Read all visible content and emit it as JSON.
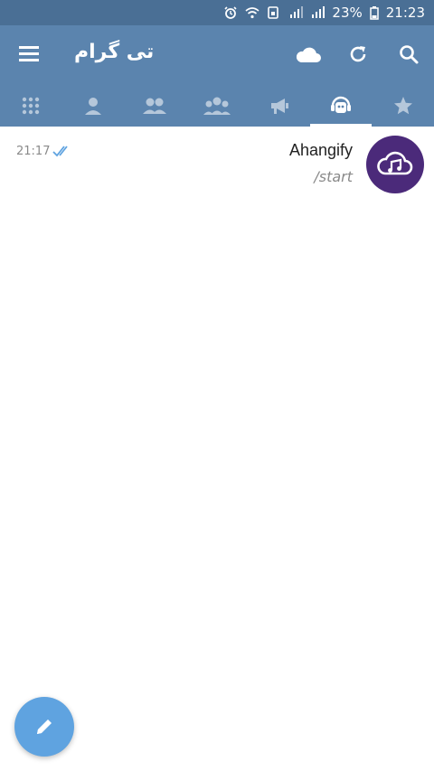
{
  "statusbar": {
    "battery_text": "23%",
    "time": "21:23",
    "icons": [
      "alarm-icon",
      "wifi-icon",
      "sim-icon",
      "signal-icon",
      "signal-icon-2",
      "battery-icon"
    ]
  },
  "appbar": {
    "title": "تی گرام",
    "menu_icon": "hamburger-menu-icon",
    "actions": [
      "cloud-icon",
      "refresh-icon",
      "search-icon"
    ]
  },
  "tabs": [
    {
      "icon": "grid-icon",
      "active": false
    },
    {
      "icon": "user-icon",
      "active": false
    },
    {
      "icon": "two-users-icon",
      "active": false
    },
    {
      "icon": "group-icon",
      "active": false
    },
    {
      "icon": "megaphone-icon",
      "active": false
    },
    {
      "icon": "bot-icon",
      "active": true
    },
    {
      "icon": "star-icon",
      "active": false
    }
  ],
  "chats": [
    {
      "name": "Ahangify",
      "preview": "/start",
      "time": "21:17",
      "status": "read",
      "avatar_icon": "cloud-music-icon",
      "avatar_color": "#4b2a7a"
    }
  ],
  "fab": {
    "icon": "pencil-icon",
    "color": "#5fa3e0"
  },
  "colors": {
    "primary": "#5b84ae",
    "statusbar": "#4a6f95",
    "check": "#5fa3e0"
  }
}
